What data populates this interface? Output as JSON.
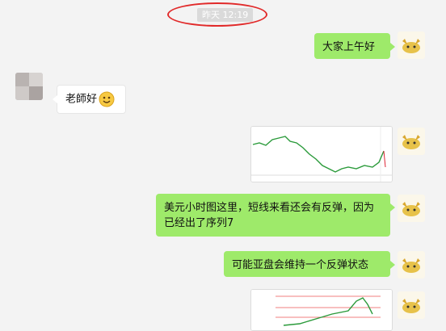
{
  "timestamp": "昨天 12:19",
  "messages": [
    {
      "side": "right",
      "type": "text",
      "text": "大家上午好"
    },
    {
      "side": "left",
      "type": "text",
      "text": "老師好",
      "emoji": "smiling-face-emoji"
    },
    {
      "side": "right",
      "type": "image",
      "image": "forex-chart-thumbnail"
    },
    {
      "side": "right",
      "type": "text",
      "text": "美元小时图这里，短线来看还会有反弹，因为已经出了序列7"
    },
    {
      "side": "right",
      "type": "text",
      "text": "可能亚盘会维持一个反弹状态"
    },
    {
      "side": "right",
      "type": "image",
      "image": "forex-chart-thumbnail"
    }
  ],
  "colors": {
    "background": "#f3f3f3",
    "outgoing_bubble": "#9eea6a",
    "incoming_bubble": "#ffffff",
    "highlight_ring": "#e12a2a"
  }
}
